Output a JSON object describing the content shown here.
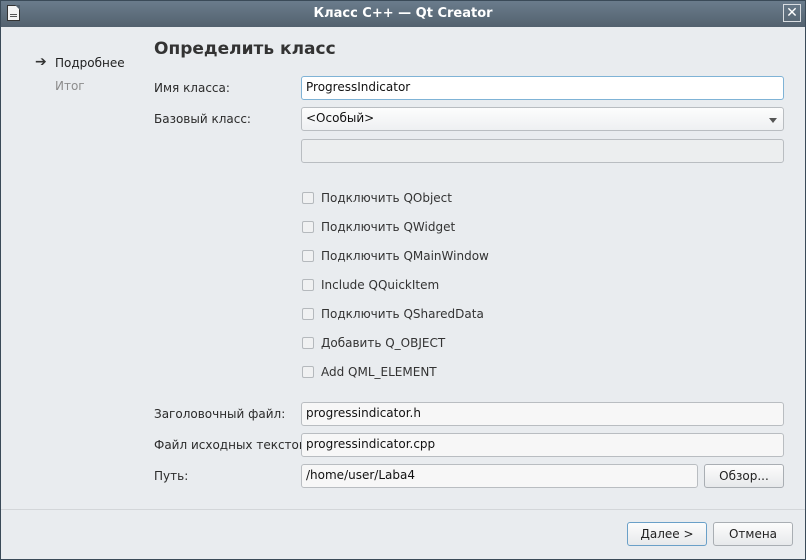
{
  "window": {
    "title": "Класс C++ — Qt Creator",
    "close_glyph": "✕"
  },
  "steps": [
    {
      "label": "Подробнее",
      "active": true,
      "icon": "arrow-right-icon"
    },
    {
      "label": "Итог",
      "active": false
    }
  ],
  "page": {
    "heading": "Определить класс"
  },
  "form": {
    "class_name_label": "Имя класса:",
    "class_name_value": "ProgressIndicator",
    "base_class_label": "Базовый класс:",
    "base_class_value": "<Особый>",
    "custom_base_value": "",
    "checkboxes": [
      {
        "label": "Подключить QObject",
        "checked": false
      },
      {
        "label": "Подключить QWidget",
        "checked": false
      },
      {
        "label": "Подключить QMainWindow",
        "checked": false
      },
      {
        "label": "Include QQuickItem",
        "checked": false
      },
      {
        "label": "Подключить QSharedData",
        "checked": false
      },
      {
        "label": "Добавить Q_OBJECT",
        "checked": false
      },
      {
        "label": "Add QML_ELEMENT",
        "checked": false
      }
    ],
    "header_file_label": "Заголовочный файл:",
    "header_file_value": "progressindicator.h",
    "source_file_label": "Файл исходных текстов:",
    "source_file_value": "progressindicator.cpp",
    "path_label": "Путь:",
    "path_value": "/home/user/Laba4",
    "browse_label": "Обзор..."
  },
  "buttons": {
    "next_label": "Далее >",
    "cancel_label": "Отмена"
  }
}
